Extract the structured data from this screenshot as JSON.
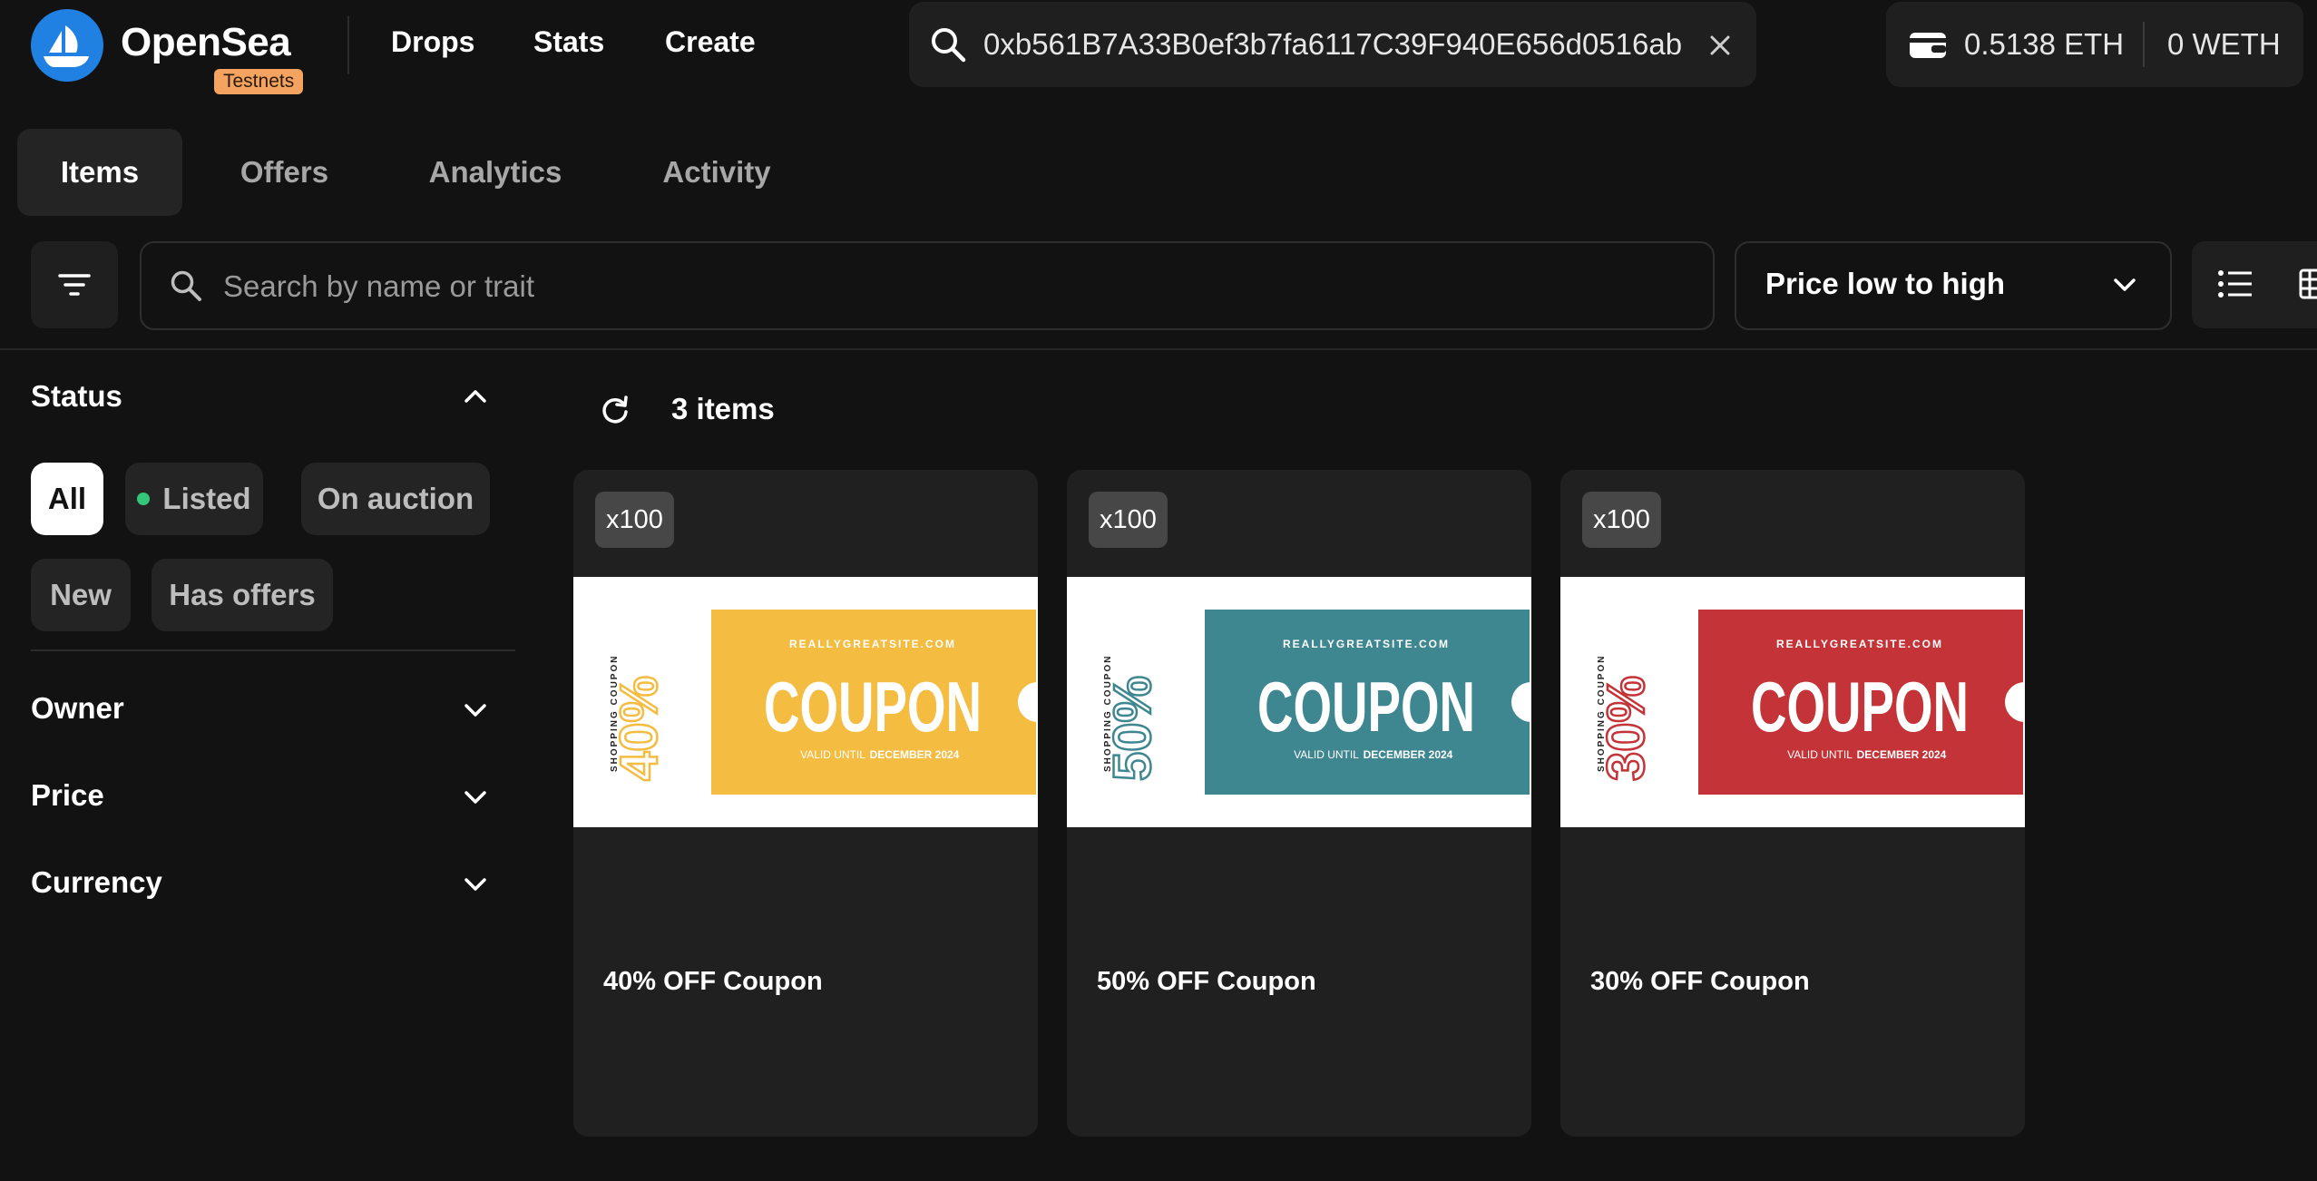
{
  "header": {
    "brand": "OpenSea",
    "badge": "Testnets",
    "nav": [
      "Drops",
      "Stats",
      "Create"
    ],
    "search_value": "0xb561B7A33B0ef3b7fa6117C39F940E656d0516ab",
    "wallet": {
      "eth": "0.5138 ETH",
      "weth": "0 WETH"
    }
  },
  "tabs": [
    "Items",
    "Offers",
    "Analytics",
    "Activity"
  ],
  "toolbar": {
    "search_placeholder": "Search by name or trait",
    "sort_label": "Price low to high"
  },
  "sidebar": {
    "status_title": "Status",
    "status_chips": [
      "All",
      "Listed",
      "On auction",
      "New",
      "Has offers"
    ],
    "sections": [
      "Owner",
      "Price",
      "Currency"
    ]
  },
  "results": {
    "count_label": "3 items"
  },
  "items": [
    {
      "qty": "x100",
      "name": "40% OFF Coupon",
      "percent": "40%",
      "color": "#f4bc41",
      "site": "REALLYGREATSITE.COM",
      "word": "COUPON",
      "valid": "VALID UNTIL",
      "date": "DECEMBER 2024",
      "side": "SHOPPING COUPON"
    },
    {
      "qty": "x100",
      "name": "50% OFF Coupon",
      "percent": "50%",
      "color": "#3f8790",
      "site": "REALLYGREATSITE.COM",
      "word": "COUPON",
      "valid": "VALID UNTIL",
      "date": "DECEMBER 2024",
      "side": "SHOPPING COUPON"
    },
    {
      "qty": "x100",
      "name": "30% OFF Coupon",
      "percent": "30%",
      "color": "#c33337",
      "site": "REALLYGREATSITE.COM",
      "word": "COUPON",
      "valid": "VALID UNTIL",
      "date": "DECEMBER 2024",
      "side": "SHOPPING COUPON"
    }
  ],
  "colors": {
    "accent": "#2081e2",
    "listed_dot": "#34c77b",
    "background": "#121212"
  }
}
